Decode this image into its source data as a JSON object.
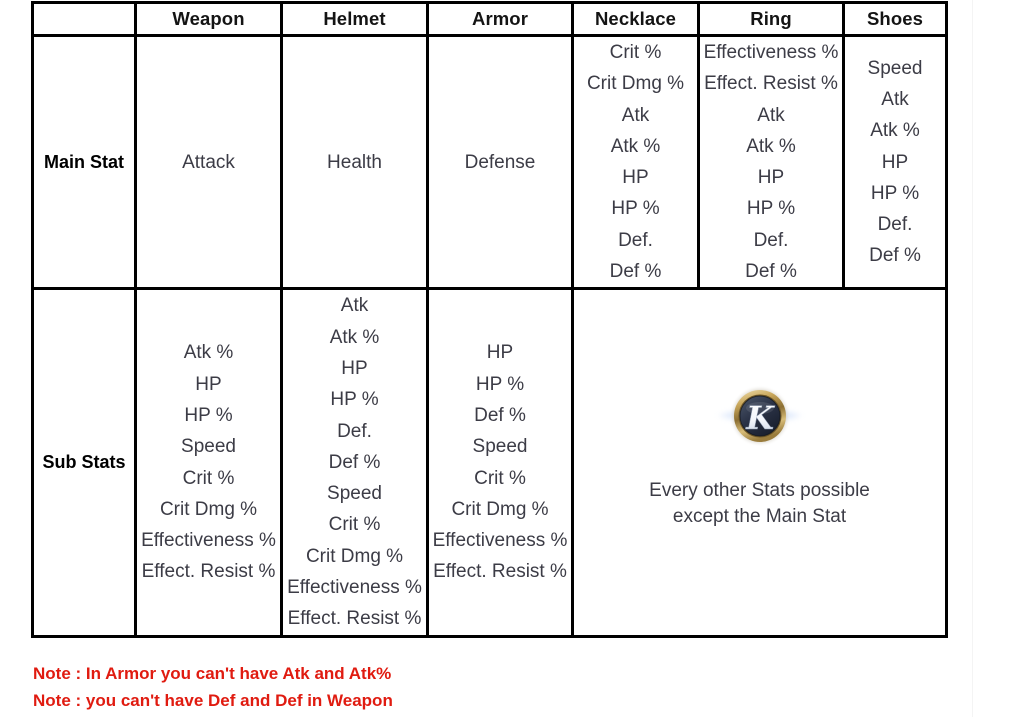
{
  "table": {
    "columns": [
      {
        "key": "weapon",
        "label": "Weapon"
      },
      {
        "key": "helmet",
        "label": "Helmet"
      },
      {
        "key": "armor",
        "label": "Armor"
      },
      {
        "key": "necklace",
        "label": "Necklace"
      },
      {
        "key": "ring",
        "label": "Ring"
      },
      {
        "key": "shoes",
        "label": "Shoes"
      }
    ],
    "rows": [
      {
        "key": "main_stat",
        "label": "Main Stat"
      },
      {
        "key": "sub_stats",
        "label": "Sub Stats"
      }
    ],
    "main_stat": {
      "weapon": [
        "Attack"
      ],
      "helmet": [
        "Health"
      ],
      "armor": [
        "Defense"
      ],
      "necklace": [
        "Crit %",
        "Crit Dmg %",
        "Atk",
        "Atk %",
        "HP",
        "HP %",
        "Def.",
        "Def %"
      ],
      "ring": [
        "Effectiveness %",
        "Effect. Resist %",
        "Atk",
        "Atk %",
        "HP",
        "HP %",
        "Def.",
        "Def %"
      ],
      "shoes": [
        "Speed",
        "Atk",
        "Atk %",
        "HP",
        "HP %",
        "Def.",
        "Def %"
      ]
    },
    "sub_stats": {
      "weapon": [
        "Atk %",
        "HP",
        "HP %",
        "Speed",
        "Crit %",
        "Crit Dmg %",
        "Effectiveness %",
        "Effect. Resist %"
      ],
      "helmet": [
        "Atk",
        "Atk %",
        "HP",
        "HP %",
        "Def.",
        "Def %",
        "Speed",
        "Crit %",
        "Crit Dmg %",
        "Effectiveness %",
        "Effect. Resist %"
      ],
      "armor": [
        "HP",
        "HP %",
        "Def %",
        "Speed",
        "Crit %",
        "Crit Dmg %",
        "Effectiveness %",
        "Effect. Resist %"
      ],
      "merged": {
        "icon": "epic-seven-emblem-icon",
        "line1": "Every other Stats possible",
        "line2": "except the Main Stat"
      }
    }
  },
  "notes": [
    "Note : In Armor you can't have Atk and Atk%",
    "Note : you can't have Def and Def in Weapon"
  ],
  "colors": {
    "header_orange": "#E8750E",
    "row_label_yellow": "#FFFF00",
    "note_red": "#E01B10",
    "body_text": "#3C3C46",
    "border": "#000000"
  }
}
